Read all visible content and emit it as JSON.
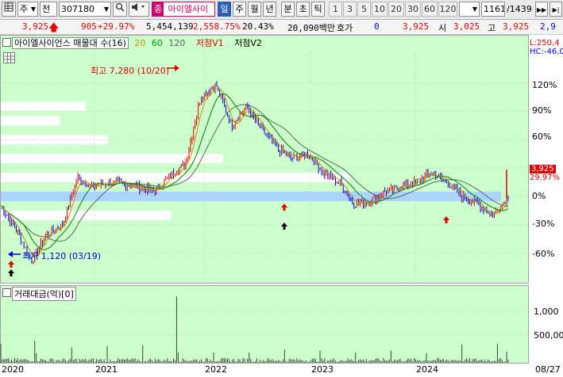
{
  "toolbar": {
    "market": "주",
    "mode": "전",
    "code": "307180",
    "stock_name": "아이엘사이",
    "periods": [
      "일",
      "주",
      "월",
      "년",
      "분",
      "초",
      "틱"
    ],
    "selected_period": "일",
    "intervals": [
      "1",
      "3",
      "5",
      "10",
      "20",
      "30",
      "60",
      "120"
    ],
    "count": "1161",
    "total": "/1439",
    "stock_tag": "종"
  },
  "price_row": {
    "price": "3,925",
    "change": "905",
    "change_pct": "+29.97%",
    "volume": "5,454,139",
    "volume_ratio": "2,558.75%",
    "turnover_pct": "20.43%",
    "amount": "20,090백만",
    "quote_label": "호가",
    "quote_value": "0",
    "current": "3,925",
    "open_label": "시",
    "open": "3,025",
    "high_label": "고",
    "high": "3,925",
    "low_partial": "2,9"
  },
  "chart_header": {
    "title": "아이엘사이언스 매물대 수(16)",
    "ma_periods": [
      "20",
      "60",
      "120"
    ],
    "ma_colors": [
      "#d8a000",
      "#00a000",
      "#606060"
    ],
    "point_label_1": "저점V1",
    "point_label_2": "저점V2"
  },
  "right_axis": {
    "top_low": "L:250,4",
    "top_high": "HC:-46,0",
    "price_tag": "3,925",
    "pct_tag": "29.97%",
    "ticks": [
      "120%",
      "90%",
      "60%",
      "30%",
      "0%",
      "-30%",
      "-60%"
    ],
    "vol_ticks": [
      "1,000",
      "500,00"
    ]
  },
  "annotations": {
    "high": "최고 7,280 (10/20)",
    "low": "최저 1,120 (03/19)"
  },
  "volume_panel": {
    "title": "거래대금(억)[0]"
  },
  "x_axis": {
    "labels": [
      "2020",
      "2021",
      "2022",
      "2023",
      "2024",
      "08/27"
    ]
  },
  "chart_data": {
    "type": "line",
    "y_unit": "% change",
    "ylim": [
      -85,
      145
    ],
    "x": [
      "2020-01",
      "2020-02",
      "2020-03",
      "2020-04",
      "2020-06",
      "2020-08",
      "2020-10",
      "2020-12",
      "2021-01",
      "2021-03",
      "2021-05",
      "2021-07",
      "2021-09",
      "2021-10",
      "2021-11",
      "2021-12",
      "2022-01",
      "2022-02",
      "2022-03",
      "2022-04",
      "2022-06",
      "2022-08",
      "2022-10",
      "2022-12",
      "2023-02",
      "2023-04",
      "2023-06",
      "2023-08",
      "2023-10",
      "2023-12",
      "2024-02",
      "2024-04",
      "2024-06",
      "2024-08"
    ],
    "series": [
      {
        "values": [
          -10,
          -35,
          -68,
          -40,
          -30,
          20,
          10,
          15,
          13,
          10,
          5,
          22,
          35,
          105,
          118,
          75,
          95,
          70,
          50,
          40,
          45,
          25,
          15,
          -8,
          -5,
          5,
          10,
          15,
          25,
          15,
          0,
          -8,
          -20,
          0
        ]
      }
    ],
    "price_zones_pct": [
      95,
      80,
      60,
      40,
      20,
      0,
      -20
    ],
    "zone_strengths": [
      0.23,
      0.16,
      0.29,
      0.6,
      0.94,
      0.95,
      0.46
    ]
  }
}
